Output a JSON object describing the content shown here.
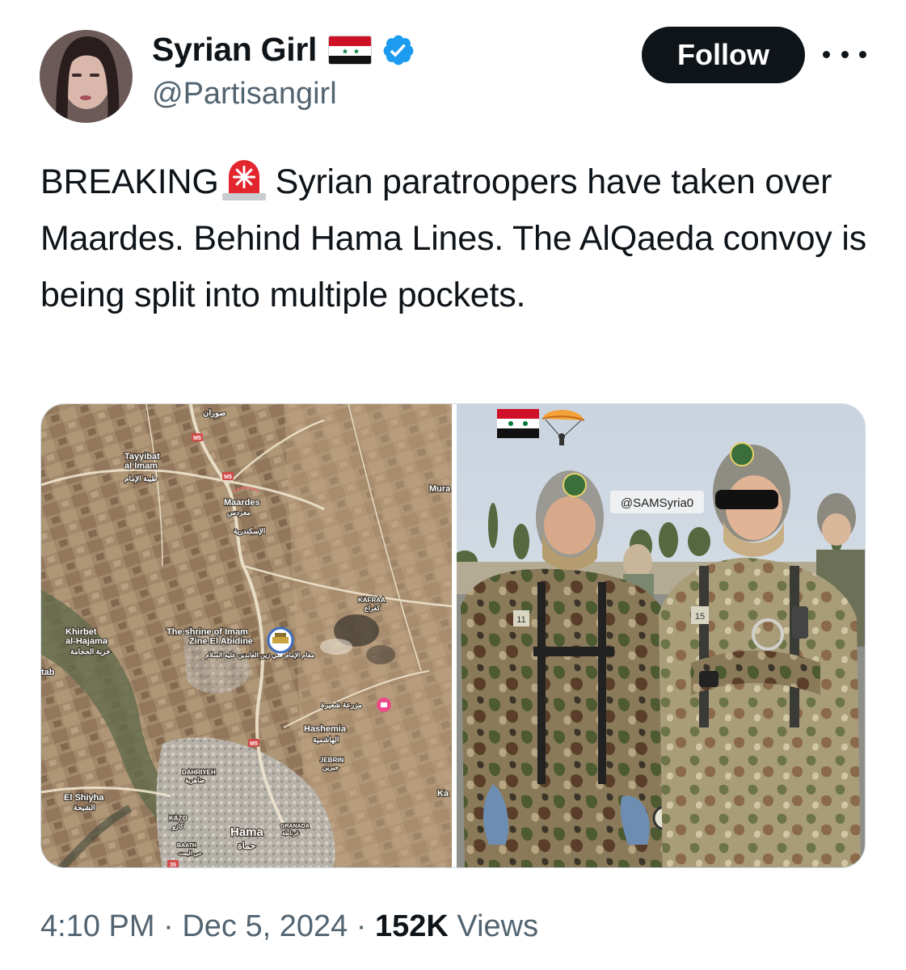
{
  "author": {
    "display_name": "Syrian Girl",
    "handle": "@Partisangirl",
    "avatar_icon": "profile-photo",
    "flag_icon": "syria-flag-emoji",
    "verified_icon": "verified-badge-icon",
    "verified_color": "#1d9bf0"
  },
  "actions": {
    "follow_label": "Follow",
    "more_icon": "more-options-icon"
  },
  "tweet": {
    "lead": "BREAKING",
    "siren_icon": "police-car-light-emoji",
    "body": "Syrian paratroopers have taken over Maardes. Behind Hama Lines. The AlQaeda convoy is being split into multiple pockets."
  },
  "media": {
    "map": {
      "places": {
        "tayyibat": "Tayyibat al Imam",
        "tayyibat_ar": "طيبة الإمام",
        "maardes": "Maardes",
        "maardes_ar": "معردس",
        "iskandariya_ar": "الإسكندرية",
        "kafraa": "KAFRAA",
        "kafraa_ar": "كفراع",
        "khirbet": "Khirbet al-Hajama",
        "khirbet_ar": "خربة الحجامة",
        "shrine": "The shrine of Imam Zine El Abidine",
        "shrine_ar": "مقام الإمام علي زين العابدين عليه السلام",
        "hashemia": "Hashemia",
        "hashemia_ar": "الهاشمية",
        "farm_ar": "مزرعة شعيرة",
        "jebrin": "JEBRIN",
        "jebrin_ar": "جبرين",
        "dahriyeh": "DAHRIYEH",
        "dahriyeh_ar": "ضاهرية",
        "shiyha": "El Shiyha",
        "shiyha_ar": "الشيحة",
        "kazo": "KAZO",
        "kazo_ar": "كازو",
        "hama": "Hama",
        "hama_ar": "حماة",
        "granada": "GRANADA",
        "granada_ar": "غرناطة",
        "baath": "BAATH",
        "baath_ar": "حي البعث",
        "tab": "tab",
        "mura": "Mura",
        "ka": "Ka",
        "top_ar": "صوران"
      },
      "roads": {
        "m5": "M5",
        "r35": "35"
      },
      "colors": {
        "terrain": "#a08a6e",
        "road": "#e8dcc4",
        "pin": "#ea4c89"
      }
    },
    "photo": {
      "watermark": "@SAMSyria0",
      "patch_left": "11",
      "patch_right": "15",
      "flag_icon": "syria-flag-emoji",
      "parachute_icon": "parachutist-emoji"
    }
  },
  "meta": {
    "time": "4:10 PM",
    "date": "Dec 5, 2024",
    "views_count": "152K",
    "views_label": "Views",
    "separator": "·"
  }
}
